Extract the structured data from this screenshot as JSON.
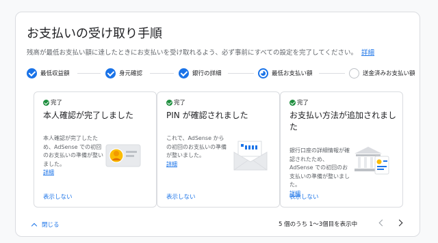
{
  "header": {
    "title": "お支払いの受け取り手順",
    "description": "残高が最低お支払い額に達したときにお支払いを受け取れるよう、必ず事前にすべての設定を完了してください。",
    "details_link": "詳細"
  },
  "steps": [
    {
      "label": "最低収益額",
      "state": "done"
    },
    {
      "label": "身元確認",
      "state": "done"
    },
    {
      "label": "銀行の詳細",
      "state": "done"
    },
    {
      "label": "最低お支払い額",
      "state": "current"
    },
    {
      "label": "送金済みお支払い額",
      "state": "todo"
    }
  ],
  "cards": [
    {
      "status": "完了",
      "title": "本人確認が完了しました",
      "body": "本人確認が完了したため、AdSense での初回のお支払いの準備が整いました。",
      "link": "詳細",
      "dismiss": "表示しない",
      "icon": "id-card-icon"
    },
    {
      "status": "完了",
      "title": "PIN が確認されました",
      "body": "これで、AdSense からの初回のお支払いの準備が整いました。",
      "link": "詳細",
      "dismiss": "表示しない",
      "icon": "envelope-icon"
    },
    {
      "status": "完了",
      "title": "お支払い方法が追加されました",
      "body": "銀行口座の詳細情報が確認されたため、AdSense での初回のお支払いの準備が整いました。",
      "link": "詳細",
      "dismiss": "表示しない",
      "icon": "bank-icon"
    }
  ],
  "footer": {
    "collapse_label": "閉じる",
    "pager_text": "5 個のうち 1〜3個目を表示中"
  },
  "colors": {
    "accent": "#1a73e8",
    "success": "#1e8e3e",
    "border": "#dadce0"
  }
}
